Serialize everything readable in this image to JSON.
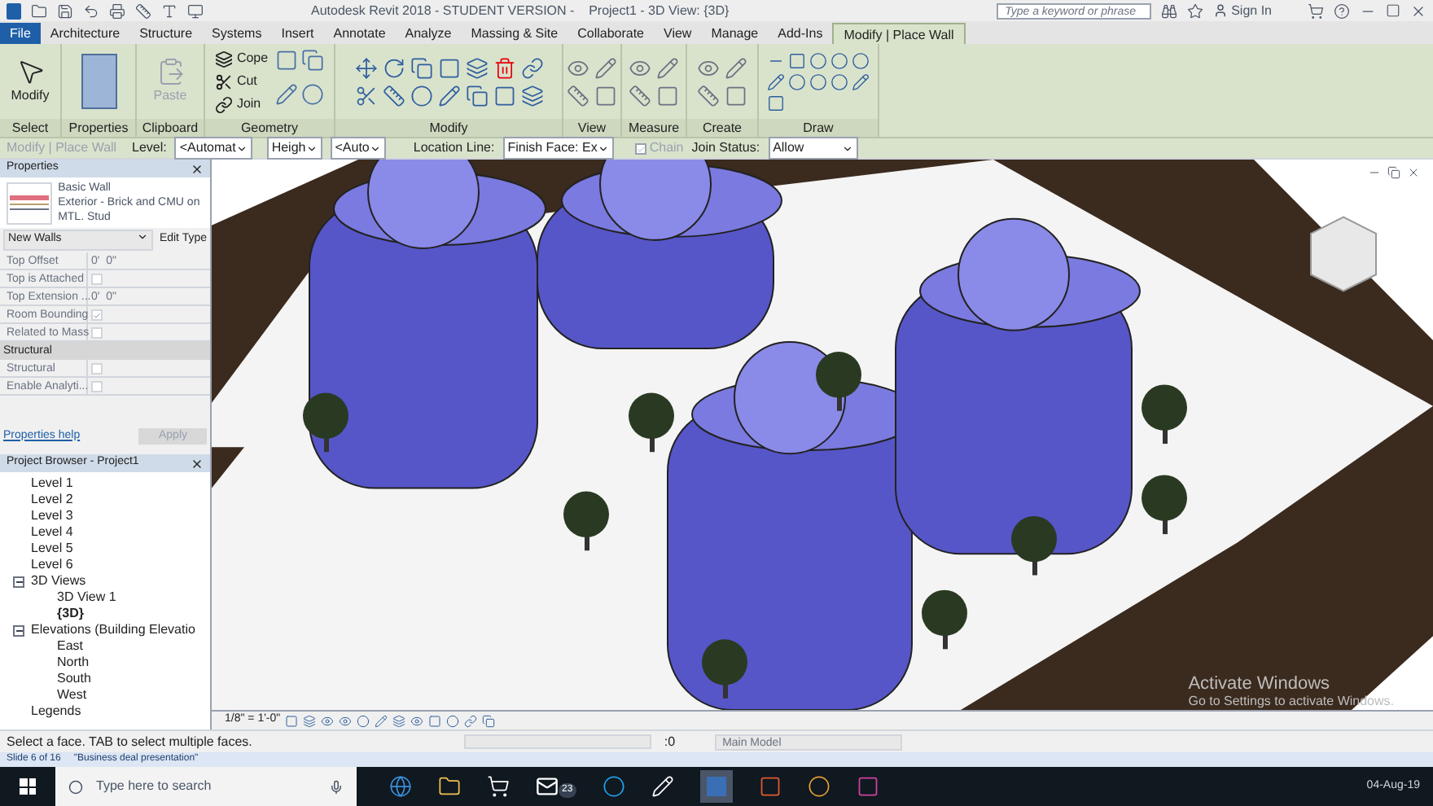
{
  "title_bar": {
    "title": "Autodesk Revit 2018 - STUDENT VERSION -    Project1 - 3D View: {3D}",
    "search_placeholder": "Type a keyword or phrase",
    "sign_in": "Sign In"
  },
  "tabs": [
    {
      "label": "File",
      "kind": "file",
      "selected": false
    },
    {
      "label": "Architecture",
      "kind": "normal",
      "selected": false
    },
    {
      "label": "Structure",
      "kind": "normal",
      "selected": false
    },
    {
      "label": "Systems",
      "kind": "normal",
      "selected": false
    },
    {
      "label": "Insert",
      "kind": "normal",
      "selected": false
    },
    {
      "label": "Annotate",
      "kind": "normal",
      "selected": false
    },
    {
      "label": "Analyze",
      "kind": "normal",
      "selected": false
    },
    {
      "label": "Massing & Site",
      "kind": "normal",
      "selected": false
    },
    {
      "label": "Collaborate",
      "kind": "normal",
      "selected": false
    },
    {
      "label": "View",
      "kind": "normal",
      "selected": false
    },
    {
      "label": "Manage",
      "kind": "normal",
      "selected": false
    },
    {
      "label": "Add-Ins",
      "kind": "normal",
      "selected": false
    },
    {
      "label": "Modify | Place Wall",
      "kind": "contextual",
      "selected": true
    }
  ],
  "ribbon": {
    "panels": [
      {
        "label": "Select",
        "kind": "big",
        "buttons": [
          "Modify"
        ]
      },
      {
        "label": "Properties",
        "kind": "big"
      },
      {
        "label": "Clipboard",
        "kind": "paste",
        "buttons": [
          "Paste"
        ]
      },
      {
        "label": "Geometry",
        "kind": "list",
        "buttons": [
          "Cope",
          "Cut",
          "Join"
        ]
      },
      {
        "label": "Modify",
        "kind": "grid"
      },
      {
        "label": "View",
        "kind": "small"
      },
      {
        "label": "Measure",
        "kind": "small"
      },
      {
        "label": "Create",
        "kind": "small"
      },
      {
        "label": "Draw",
        "kind": "draw"
      }
    ]
  },
  "options_bar": {
    "mode": "Modify | Place Wall",
    "level_label": "Level:",
    "level": "<Automat",
    "height": "Heigh",
    "height_value": "<Auto",
    "location_label": "Location Line:",
    "location": "Finish Face: Ex",
    "chain": {
      "label": "Chain",
      "checked": true,
      "disabled": true
    },
    "join_label": "Join Status:",
    "join": "Allow"
  },
  "properties": {
    "title": "Properties",
    "family": "Basic Wall",
    "type": "Exterior - Brick and CMU on MTL. Stud",
    "selector": "New Walls",
    "edit_type": "Edit Type",
    "rows": [
      {
        "kind": "text",
        "name": "Top Offset",
        "value": "0'  0\""
      },
      {
        "kind": "check",
        "name": "Top is Attached",
        "checked": false
      },
      {
        "kind": "text",
        "name": "Top Extension ...",
        "value": "0'  0\""
      },
      {
        "kind": "check",
        "name": "Room Bounding",
        "checked": true
      },
      {
        "kind": "check",
        "name": "Related to Mass",
        "checked": false
      },
      {
        "kind": "group",
        "name": "Structural"
      },
      {
        "kind": "check",
        "name": "Structural",
        "checked": false
      },
      {
        "kind": "check",
        "name": "Enable Analyti...",
        "checked": false
      }
    ],
    "help": "Properties help",
    "apply": "Apply"
  },
  "project_browser": {
    "title": "Project Browser - Project1",
    "tree": [
      {
        "label": "Level 1",
        "selected": false
      },
      {
        "label": "Level 2",
        "selected": false
      },
      {
        "label": "Level 3",
        "selected": false
      },
      {
        "label": "Level 4",
        "selected": false
      },
      {
        "label": "Level 5",
        "selected": false
      },
      {
        "label": "Level 6",
        "selected": false
      },
      {
        "label": "3D Views",
        "expanded": true,
        "selected": false,
        "children": [
          {
            "label": "3D View 1",
            "selected": false
          },
          {
            "label": "{3D}",
            "selected": true
          }
        ]
      },
      {
        "label": "Elevations (Building Elevatio",
        "expanded": true,
        "selected": false,
        "children": [
          {
            "label": "East",
            "selected": false
          },
          {
            "label": "North",
            "selected": false
          },
          {
            "label": "South",
            "selected": false
          },
          {
            "label": "West",
            "selected": false
          }
        ]
      },
      {
        "label": "Legends",
        "selected": false
      }
    ]
  },
  "view_bar": {
    "scale": "1/8\" = 1'-0\""
  },
  "activation": {
    "title": "Activate Windows",
    "hint": "Go to Settings to activate Windows."
  },
  "status_bar": {
    "message": "Select a face. TAB to select multiple faces.",
    "count": ":0",
    "model": "Main Model"
  },
  "slide_bar": {
    "slide": "Slide 6 of 16",
    "title": "\"Business deal presentation\""
  },
  "taskbar": {
    "search_placeholder": "Type here to search",
    "mail_badge": "23",
    "date": "04-Aug-19"
  }
}
